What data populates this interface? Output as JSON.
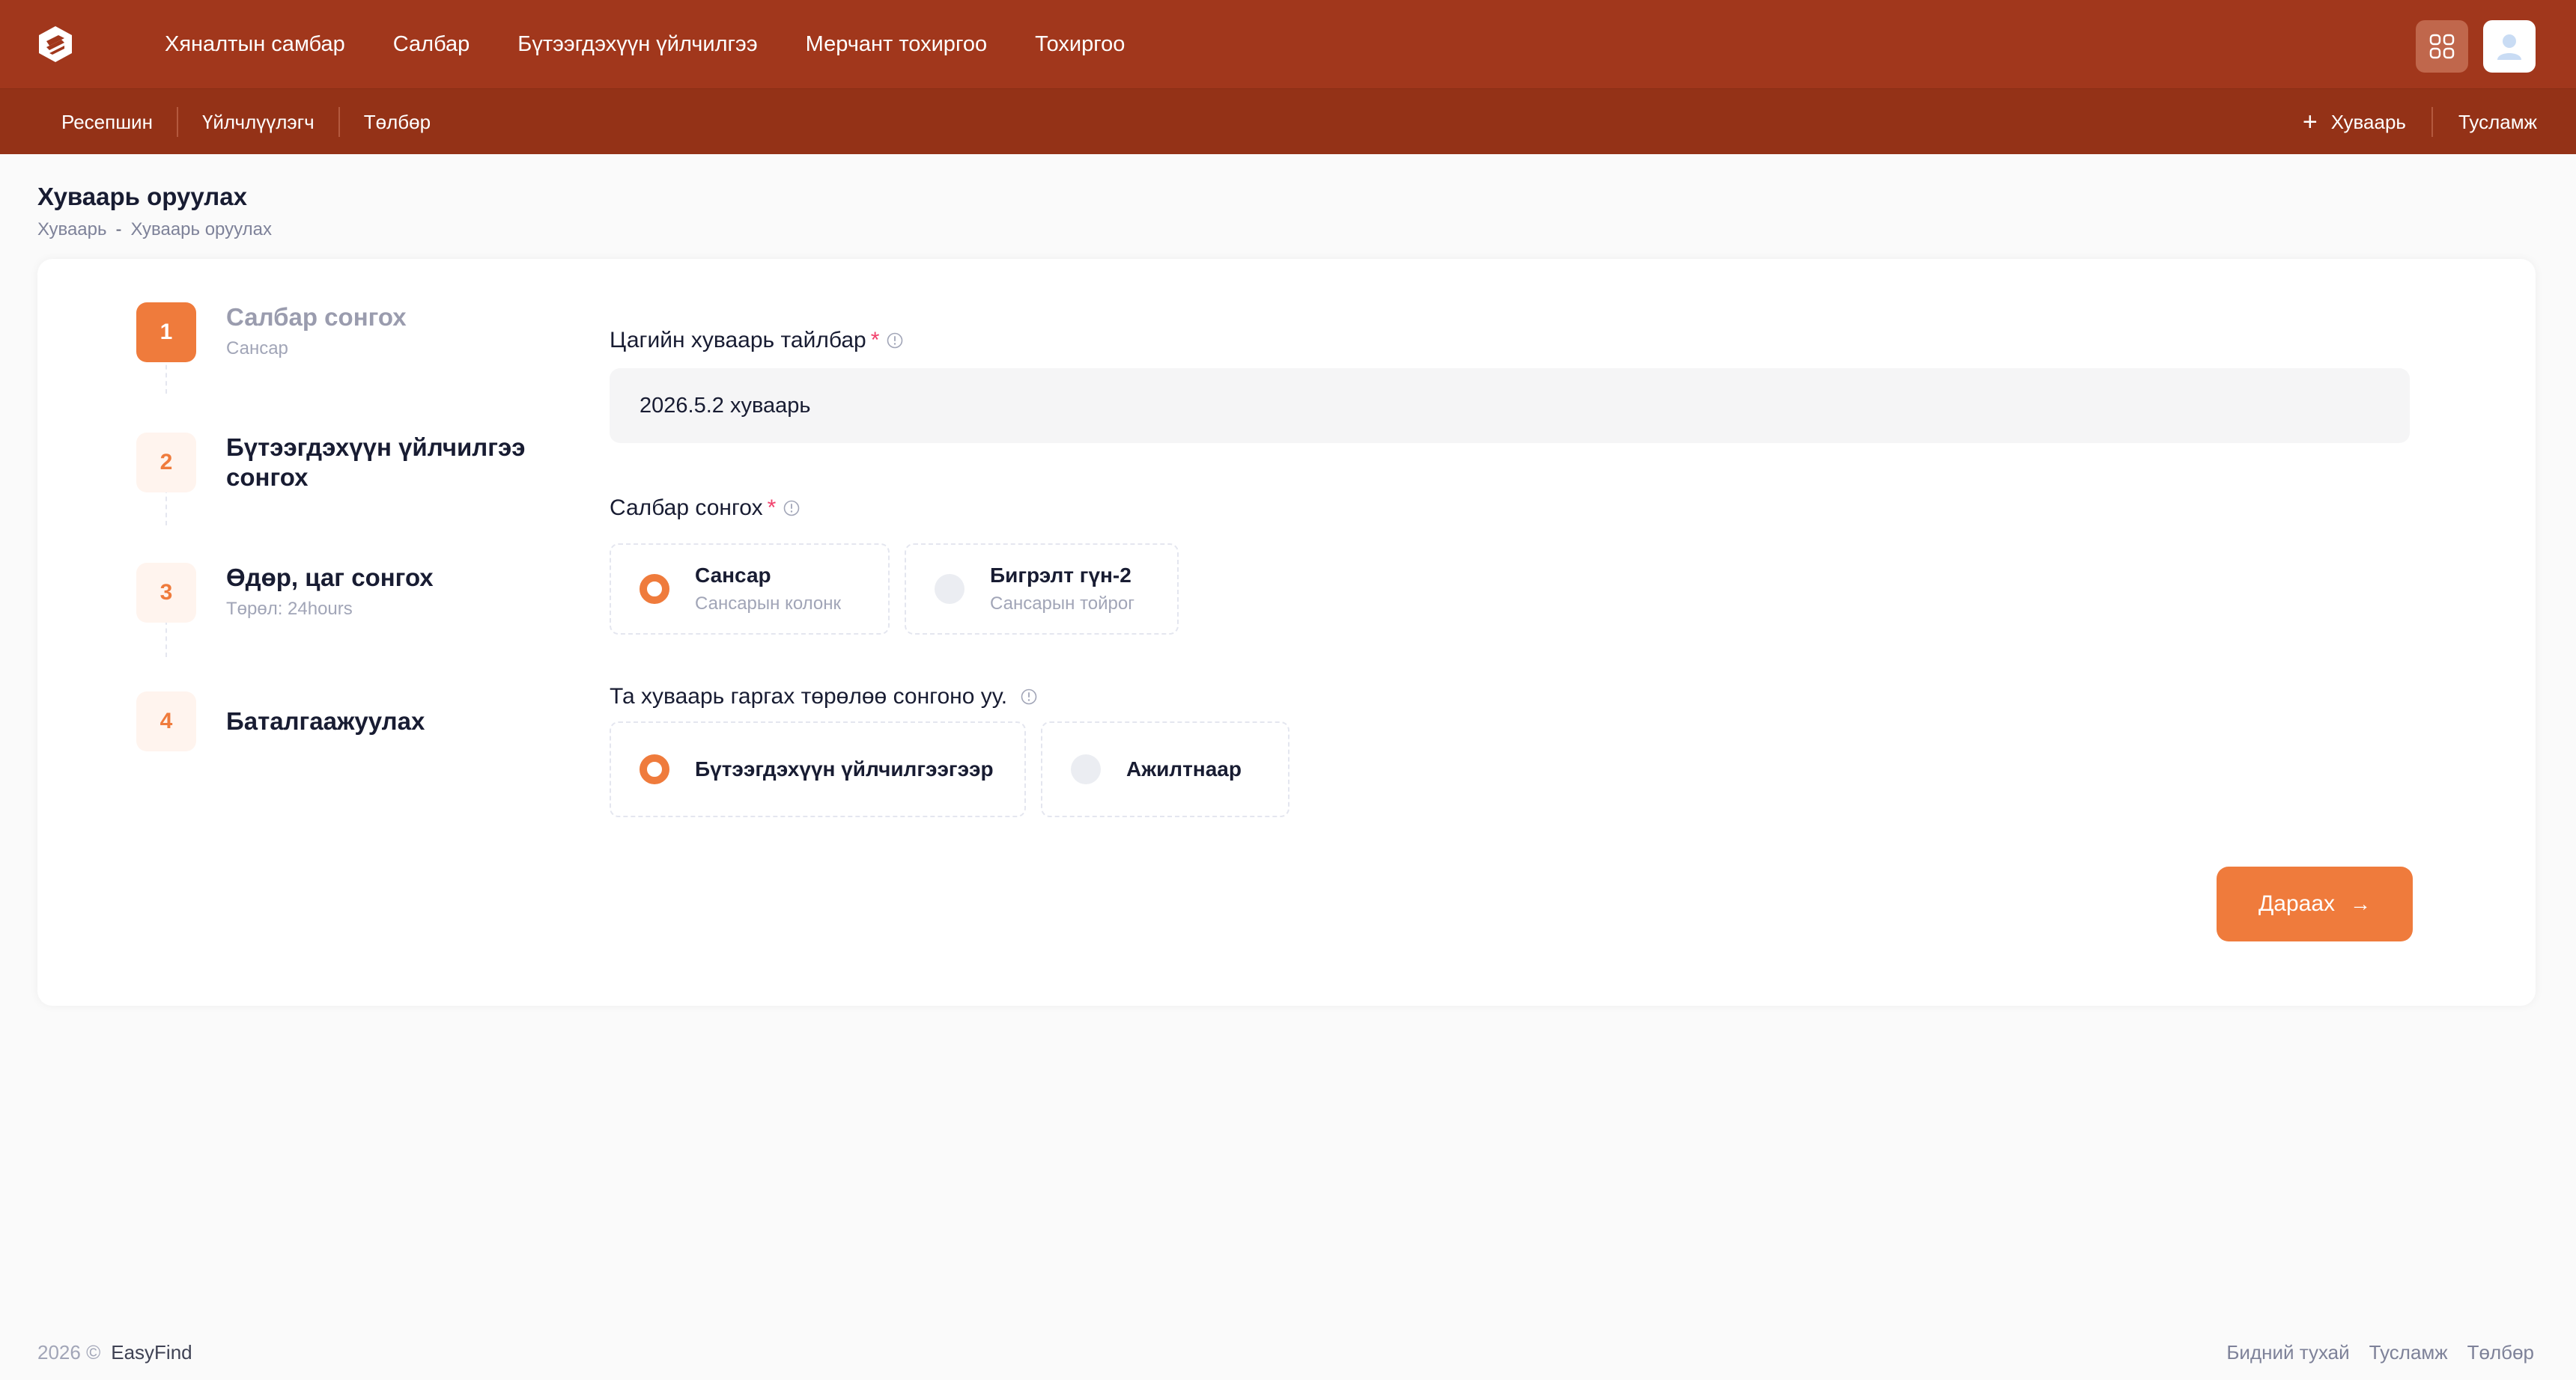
{
  "header": {
    "logo_icon": "easyfind-logo-icon",
    "nav": [
      "Хяналтын самбар",
      "Салбар",
      "Бүтээгдэхүүн үйлчилгээ",
      "Мерчант тохиргоо",
      "Тохиргоо"
    ],
    "apps_icon": "grid-icon",
    "avatar_icon": "user-icon"
  },
  "subnav": {
    "left": [
      "Ресепшин",
      "Үйлчлүүлэгч",
      "Төлбөр"
    ],
    "add_schedule": "Хуваарь",
    "help": "Тусламж"
  },
  "page": {
    "title": "Хуваарь оруулах",
    "breadcrumb": [
      "Хуваарь",
      "Хуваарь оруулах"
    ],
    "breadcrumb_sep": "-"
  },
  "steps": [
    {
      "num": "1",
      "title": "Салбар сонгох",
      "sub": "Сансар"
    },
    {
      "num": "2",
      "title": "Бүтээгдэхүүн үйлчилгээ",
      "title2": "сонгох",
      "sub": ""
    },
    {
      "num": "3",
      "title": "Өдөр, цаг сонгох",
      "sub": "Төрөл: 24hours"
    },
    {
      "num": "4",
      "title": "Баталгаажуулах",
      "sub": ""
    }
  ],
  "form": {
    "desc_label": "Цагийн хуваарь тайлбар",
    "desc_value": "2026.5.2 хуваарь",
    "required_mark": "*",
    "branch_label": "Салбар сонгох",
    "branches": [
      {
        "title": "Сансар",
        "sub": "Сансарын колонк",
        "selected": true
      },
      {
        "title": "Бигрэлт гүн-2",
        "sub": "Сансарын тойрог",
        "selected": false
      }
    ],
    "type_label": "Та хуваарь гаргах төрөлөө сонгоно уу.",
    "types": [
      {
        "title": "Бүтээгдэхүүн үйлчилгээгээр",
        "selected": true
      },
      {
        "title": "Ажилтнаар",
        "selected": false
      }
    ],
    "next_label": "Дараах"
  },
  "footer": {
    "copyright": "2026 ©",
    "brand": "EasyFind",
    "links": [
      "Бидний тухай",
      "Тусламж",
      "Төлбөр"
    ]
  },
  "colors": {
    "header_bg": "#a1371c",
    "subbar_bg": "#943217",
    "accent": "#ef7b3c"
  }
}
